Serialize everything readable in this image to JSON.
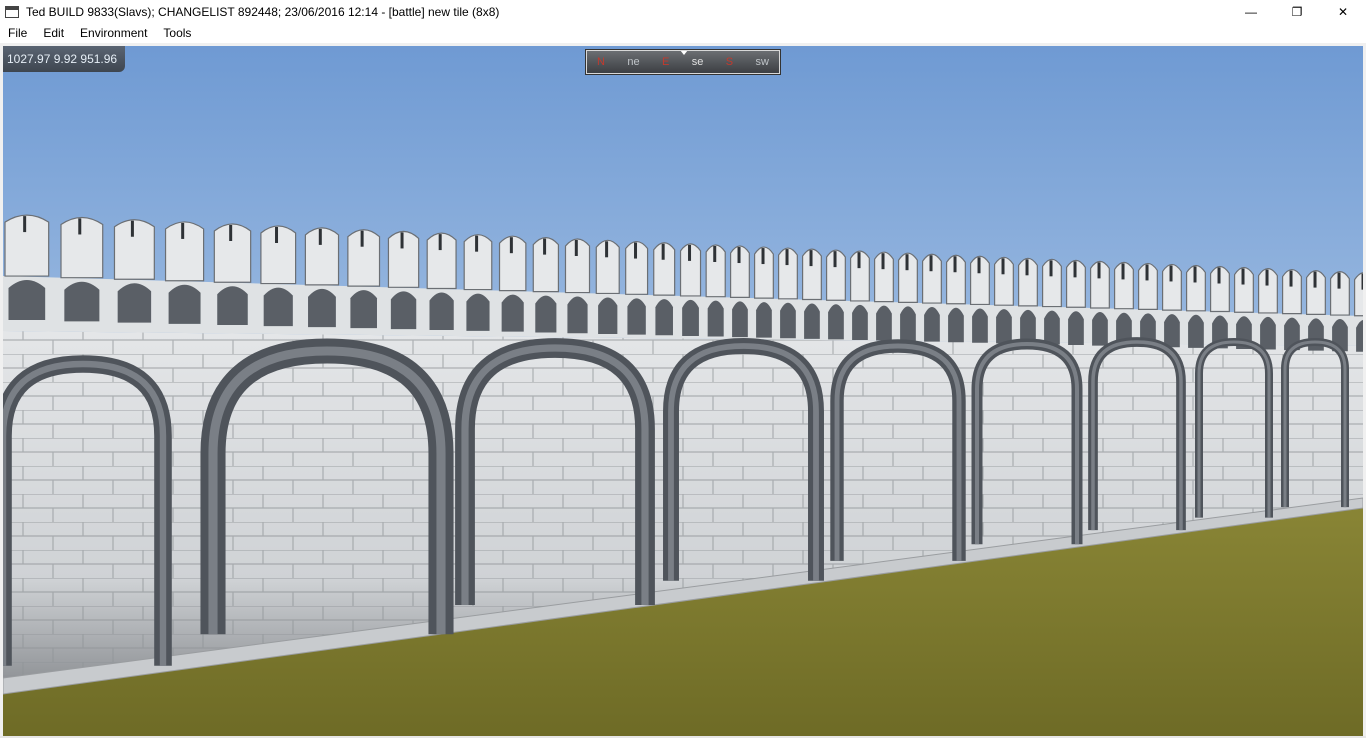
{
  "window": {
    "title": "Ted BUILD 9833(Slavs); CHANGELIST 892448; 23/06/2016 12:14 - [battle] new tile (8x8)",
    "controls": {
      "minimize": "—",
      "restore": "❐",
      "close": "✕"
    }
  },
  "menu": {
    "items": [
      "File",
      "Edit",
      "Environment",
      "Tools"
    ]
  },
  "hud": {
    "coordinates": "1027.97  9.92  951.96",
    "compass": {
      "labels": [
        "N",
        "ne",
        "E",
        "se",
        "S",
        "sw"
      ]
    }
  },
  "scene": {
    "colors": {
      "sky_top": "#6f9ad3",
      "sky_bottom": "#cfe0f1",
      "wall": "#d9dcdf",
      "arch": "#5c6168",
      "grass": "#7d7a2c",
      "parapet": "#e3e5e7"
    }
  }
}
